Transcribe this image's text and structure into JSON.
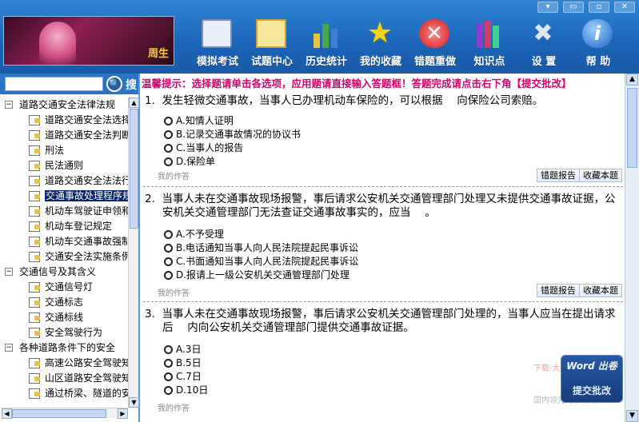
{
  "toolbar": {
    "items": [
      {
        "label": "模拟考试",
        "icon": "notepad-icon"
      },
      {
        "label": "试题中心",
        "icon": "notebook-icon"
      },
      {
        "label": "历史统计",
        "icon": "bar-chart-icon"
      },
      {
        "label": "我的收藏",
        "icon": "star-icon"
      },
      {
        "label": "错题重做",
        "icon": "error-cross-icon"
      },
      {
        "label": "知识点",
        "icon": "books-icon"
      },
      {
        "label": "设 置",
        "icon": "tools-icon"
      },
      {
        "label": "帮 助",
        "icon": "info-icon"
      }
    ]
  },
  "banner": {
    "logo": "周生"
  },
  "search": {
    "label": "搜",
    "value": "",
    "button_icon": "search-icon"
  },
  "tree": [
    {
      "level": 0,
      "label": "道路交通安全法律法规",
      "expanded": true
    },
    {
      "level": 1,
      "label": "道路交通安全法选择"
    },
    {
      "level": 1,
      "label": "道路交通安全法判断"
    },
    {
      "level": 1,
      "label": "刑法"
    },
    {
      "level": 1,
      "label": "民法通则"
    },
    {
      "level": 1,
      "label": "道路交通安全法法行"
    },
    {
      "level": 1,
      "label": "交通事故处理程序规",
      "selected": true
    },
    {
      "level": 1,
      "label": "机动车驾驶证申领和"
    },
    {
      "level": 1,
      "label": "机动车登记规定"
    },
    {
      "level": 1,
      "label": "机动车交通事故强制"
    },
    {
      "level": 1,
      "label": "交通安全法实施条例"
    },
    {
      "level": 0,
      "label": "交通信号及其含义",
      "expanded": true
    },
    {
      "level": 1,
      "label": "交通信号灯"
    },
    {
      "level": 1,
      "label": "交通标志"
    },
    {
      "level": 1,
      "label": "交通标线"
    },
    {
      "level": 1,
      "label": "安全驾驶行为"
    },
    {
      "level": 0,
      "label": "各种道路条件下的安全",
      "expanded": true
    },
    {
      "level": 1,
      "label": "高速公路安全驾驶知"
    },
    {
      "level": 1,
      "label": "山区道路安全驾驶知"
    },
    {
      "level": 1,
      "label": "通过桥梁、隧道的安"
    }
  ],
  "tip": "温馨提示：选择题请单击各选项，应用题请直接输入答题框！答题完成请点击右下角【提交批改】",
  "questions": [
    {
      "number": "1.",
      "text": "发生轻微交通事故，当事人已办理机动车保险的，可以根据　  向保险公司索赔。",
      "options": [
        "A.知情人证明",
        "B.记录交通事故情况的协议书",
        "C.当事人的报告",
        "D.保险单"
      ],
      "note": "我的作答",
      "report_label": "错题报告",
      "collect_label": "收藏本题"
    },
    {
      "number": "2.",
      "text": "当事人未在交通事故现场报警，事后请求公安机关交通管理部门处理又未提供交通事故证据，公安机关交通管理部门无法查证交通事故事实的，应当　  。",
      "options": [
        "A.不予受理",
        "B.电话通知当事人向人民法院提起民事诉讼",
        "C.书面通知当事人向人民法院提起民事诉讼",
        "D.报请上一级公安机关交通管理部门处理"
      ],
      "note": "我的作答",
      "report_label": "错题报告",
      "collect_label": "收藏本题"
    },
    {
      "number": "3.",
      "text": "当事人未在交通事故现场报警，事后请求公安机关交通管理部门处理的，当事人应当在提出请求后　  内向公安机关交通管理部门提供交通事故证据。",
      "options": [
        "A.3日",
        "B.5日",
        "C.7日",
        "D.10日"
      ],
      "note": "我的作答",
      "report_label": "错题报告",
      "collect_label": "收藏本题"
    }
  ],
  "submit": {
    "brand": "Word 出卷",
    "label": "提交批改"
  },
  "watermark": {
    "line1": "下载·大全",
    "line2": "国内领先的下载站"
  }
}
